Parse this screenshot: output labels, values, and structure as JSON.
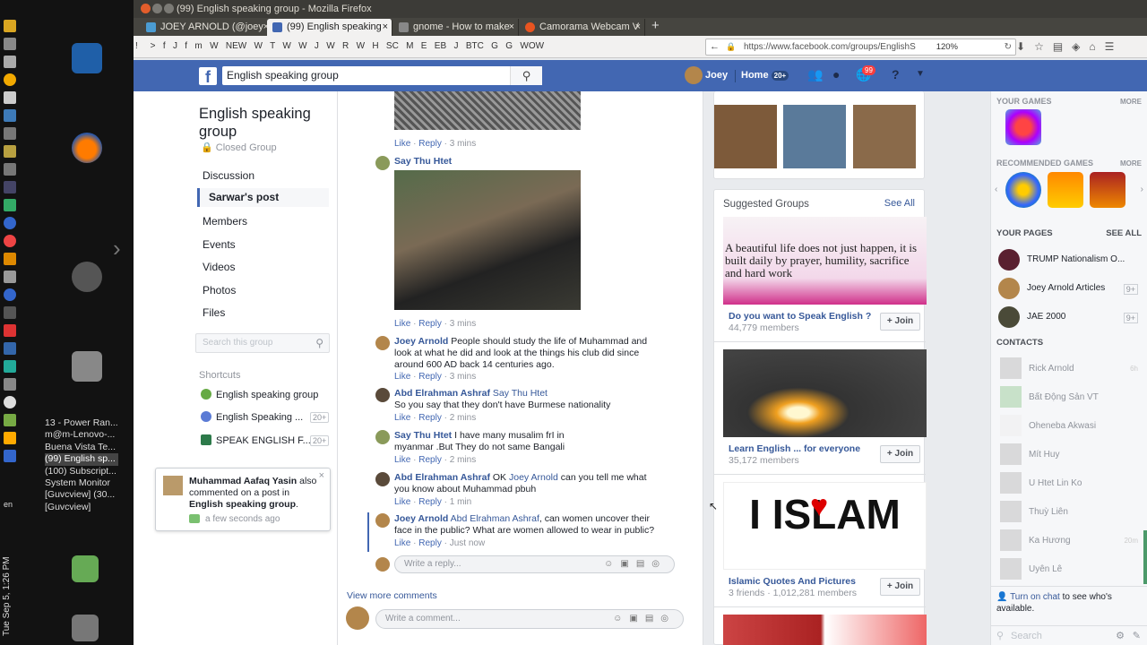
{
  "window": {
    "title": "(99) English speaking group - Mozilla Firefox"
  },
  "tabs": [
    {
      "label": "JOEY ARNOLD (@joey"
    },
    {
      "label": "(99) English speaking"
    },
    {
      "label": "gnome - How to make"
    },
    {
      "label": "Camorama Webcam V"
    }
  ],
  "bookmarks": "!     >   f   J   f   m   W   NEW   W   T   W   W   J   W   R   W   H   SC   M   E   EB   J   BTC   G   G   WOW",
  "url": "https://www.facebook.com/groups/EnglishS",
  "zoom": "120%",
  "launcher": {
    "windows": [
      "13 - Power Ran...",
      "m@m-Lenovo-...",
      "Buena Vista Te...",
      "(99) English sp...",
      "(100) Subscript...",
      "System Monitor",
      "[Guvcview] (30...",
      "[Guvcview]"
    ],
    "lang": "en",
    "clock": "Tue Sep 5, 1:26 PM"
  },
  "fb": {
    "search_value": "English speaking group",
    "user": "Joey",
    "home": "Home",
    "home_badge": "20+",
    "notif_badge": "99"
  },
  "group": {
    "name": "English speaking group",
    "privacy": "Closed Group",
    "nav": [
      "Discussion",
      "Sarwar's post",
      "Members",
      "Events",
      "Videos",
      "Photos",
      "Files"
    ],
    "search_placeholder": "Search this group",
    "shortcuts_title": "Shortcuts",
    "shortcuts": [
      {
        "label": "English speaking group",
        "count": ""
      },
      {
        "label": "English Speaking ...",
        "count": "20+"
      },
      {
        "label": "SPEAK ENGLISH F...",
        "count": "20+"
      }
    ]
  },
  "comments": [
    {
      "name": "",
      "text": "",
      "time": "3 mins"
    },
    {
      "name": "Say Thu Htet",
      "text": "",
      "time": "3 mins"
    },
    {
      "name": "Joey Arnold",
      "text": "People should study the life of Muhammad and look at what he did and look at the things his club did since around 600 AD back 14 centuries ago.",
      "time": "3 mins"
    },
    {
      "name": "Abd Elrahman Ashraf",
      "tag": "Say Thu Htet",
      "text": "So you say that they don't have Burmese nationality",
      "time": "2 mins"
    },
    {
      "name": "Say Thu Htet",
      "text": "I have many musalim frI in myanmar .But They do not same Bangali",
      "time": "2 mins"
    },
    {
      "name": "Abd Elrahman Ashraf",
      "pre": "OK",
      "tag": "Joey Arnold",
      "text": "can you tell me what you know about Muhammad pbuh",
      "time": "1 min"
    },
    {
      "name": "Joey Arnold",
      "tag": "Abd Elrahman Ashraf",
      "text": ", can women uncover their face in the public? What are women allowed to wear in public?",
      "time": "Just now"
    }
  ],
  "actions": {
    "like": "Like",
    "reply": "Reply",
    "sep": "·"
  },
  "reply_placeholder": "Write a reply...",
  "view_more": "View more comments",
  "comment_placeholder": "Write a comment...",
  "suggested": {
    "title": "Suggested Groups",
    "see_all": "See All",
    "image_quote": "A beautiful life does not just happen, it is built daily by prayer, humility, sacrifice and hard work",
    "image_islam": "I ISLAM",
    "join": "Join",
    "groups": [
      {
        "name": "Do you want to Speak English ?",
        "members": "44,779 members"
      },
      {
        "name": "Learn English ... for everyone",
        "members": "35,172 members"
      },
      {
        "name": "Islamic Quotes And Pictures",
        "members": "3 friends · 1,012,281 members"
      }
    ]
  },
  "sidebar": {
    "your_games": "YOUR GAMES",
    "recommended_games": "RECOMMENDED GAMES",
    "more": "MORE",
    "your_pages": "YOUR PAGES",
    "see_all": "SEE ALL",
    "pages": [
      {
        "name": "TRUMP Nationalism O...",
        "count": ""
      },
      {
        "name": "Joey Arnold Articles",
        "count": "9+"
      },
      {
        "name": "JAE 2000",
        "count": "9+"
      }
    ],
    "contacts_title": "CONTACTS",
    "contacts": [
      {
        "name": "Rick Arnold",
        "time": "6h"
      },
      {
        "name": "Bất Động Sản VT",
        "time": ""
      },
      {
        "name": "Oheneba Akwasi",
        "time": ""
      },
      {
        "name": "Mít Huy",
        "time": ""
      },
      {
        "name": "U Htet Lin Ko",
        "time": ""
      },
      {
        "name": "Thuỳ Liên",
        "time": ""
      },
      {
        "name": "Ka Hương",
        "time": "20m"
      },
      {
        "name": "Uyên Lê",
        "time": ""
      }
    ],
    "chat_note_link": "Turn on chat",
    "chat_note": "to see who's available.",
    "search_placeholder": "Search"
  },
  "notification": {
    "name": "Muhammad Aafaq Yasin",
    "text": "also commented on a post in",
    "group": "English speaking group",
    "time": "a few seconds ago"
  }
}
